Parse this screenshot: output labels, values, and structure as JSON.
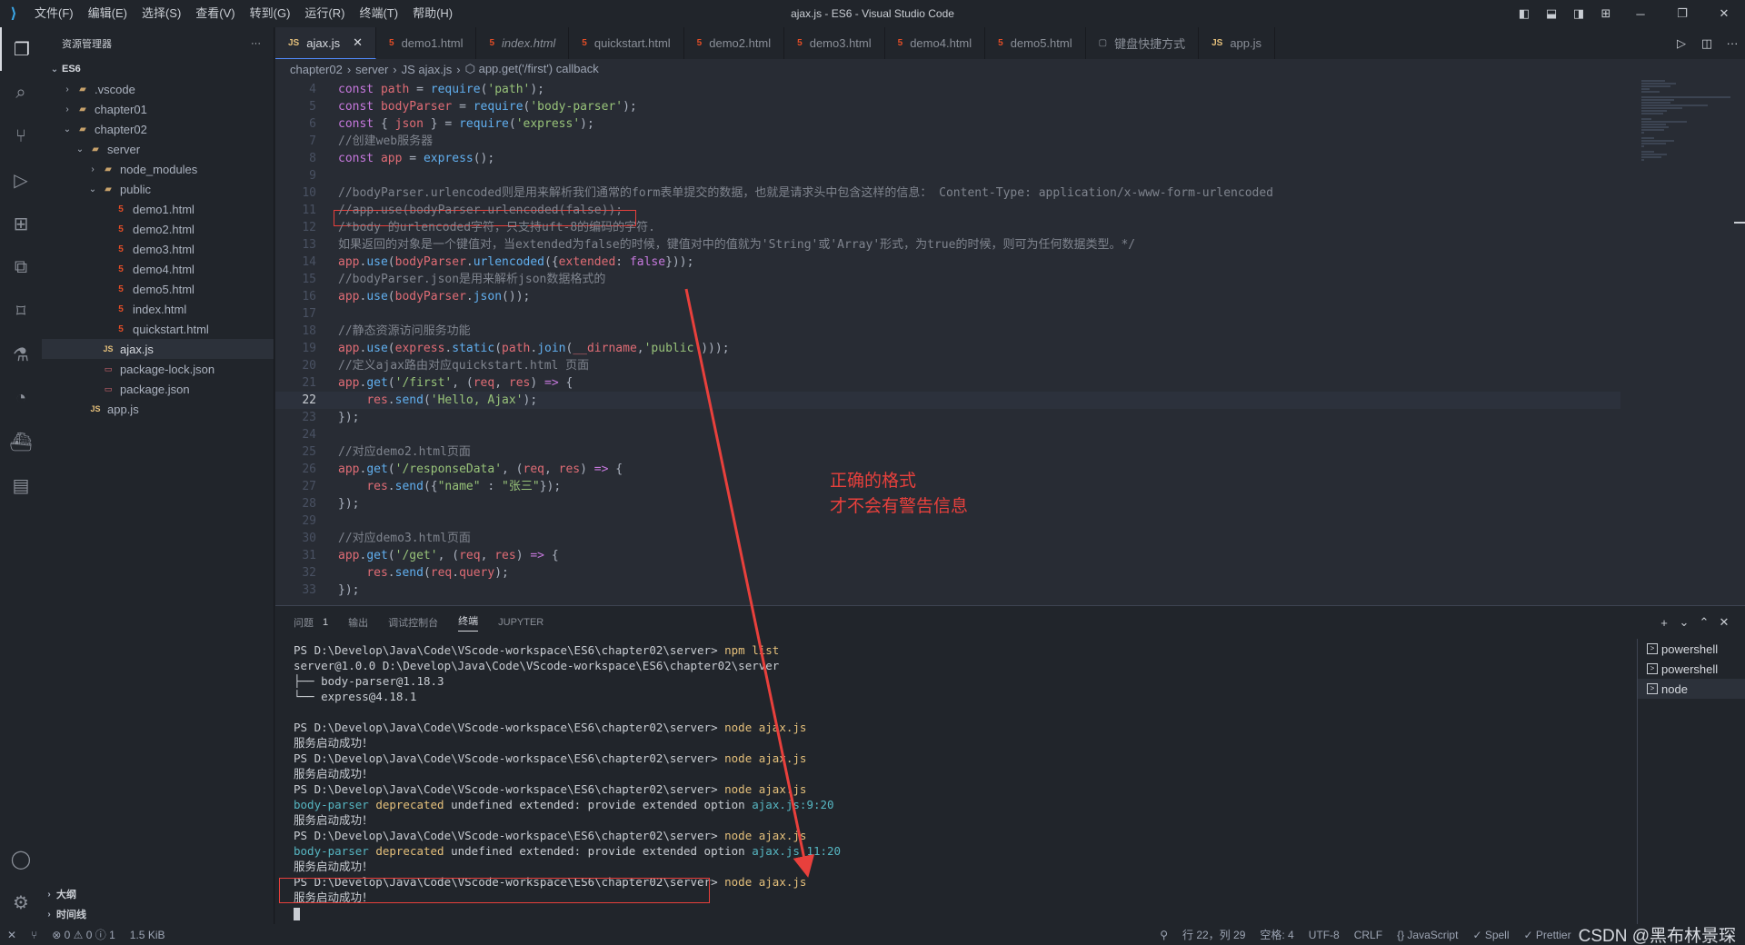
{
  "title_bar": {
    "menu": [
      "文件(F)",
      "编辑(E)",
      "选择(S)",
      "查看(V)",
      "转到(G)",
      "运行(R)",
      "终端(T)",
      "帮助(H)"
    ],
    "title": "ajax.js - ES6 - Visual Studio Code"
  },
  "sidebar": {
    "header": "资源管理器",
    "more": "···",
    "root": "ES6",
    "items": [
      {
        "label": ".vscode",
        "indent": 1,
        "kind": "folder",
        "chevron": "›"
      },
      {
        "label": "chapter01",
        "indent": 1,
        "kind": "folder",
        "chevron": "›"
      },
      {
        "label": "chapter02",
        "indent": 1,
        "kind": "folder",
        "chevron": "⌄"
      },
      {
        "label": "server",
        "indent": 2,
        "kind": "folder",
        "chevron": "⌄"
      },
      {
        "label": "node_modules",
        "indent": 3,
        "kind": "folder",
        "chevron": "›"
      },
      {
        "label": "public",
        "indent": 3,
        "kind": "folder",
        "chevron": "⌄"
      },
      {
        "label": "demo1.html",
        "indent": 4,
        "kind": "html"
      },
      {
        "label": "demo2.html",
        "indent": 4,
        "kind": "html"
      },
      {
        "label": "demo3.html",
        "indent": 4,
        "kind": "html"
      },
      {
        "label": "demo4.html",
        "indent": 4,
        "kind": "html"
      },
      {
        "label": "demo5.html",
        "indent": 4,
        "kind": "html"
      },
      {
        "label": "index.html",
        "indent": 4,
        "kind": "html"
      },
      {
        "label": "quickstart.html",
        "indent": 4,
        "kind": "html"
      },
      {
        "label": "ajax.js",
        "indent": 3,
        "kind": "js",
        "selected": true
      },
      {
        "label": "package-lock.json",
        "indent": 3,
        "kind": "json"
      },
      {
        "label": "package.json",
        "indent": 3,
        "kind": "json"
      },
      {
        "label": "app.js",
        "indent": 2,
        "kind": "js"
      }
    ],
    "outline": "大纲",
    "timeline": "时间线"
  },
  "tabs": [
    {
      "label": "ajax.js",
      "icon": "JS",
      "active": true,
      "close": "✕"
    },
    {
      "label": "demo1.html",
      "icon": "5"
    },
    {
      "label": "index.html",
      "icon": "5",
      "italic": true
    },
    {
      "label": "quickstart.html",
      "icon": "5"
    },
    {
      "label": "demo2.html",
      "icon": "5"
    },
    {
      "label": "demo3.html",
      "icon": "5"
    },
    {
      "label": "demo4.html",
      "icon": "5"
    },
    {
      "label": "demo5.html",
      "icon": "5"
    },
    {
      "label": "键盘快捷方式",
      "icon": "▢"
    },
    {
      "label": "app.js",
      "icon": "JS"
    }
  ],
  "breadcrumb": [
    "chapter02",
    "server",
    "JS ajax.js",
    "⬡ app.get('/first') callback"
  ],
  "code": [
    {
      "n": "4",
      "segs": [
        [
          "kw",
          "const "
        ],
        [
          "var",
          "path"
        ],
        [
          "plain",
          " = "
        ],
        [
          "fn",
          "require"
        ],
        [
          "plain",
          "("
        ],
        [
          "str",
          "'path'"
        ],
        [
          "plain",
          ");"
        ]
      ]
    },
    {
      "n": "5",
      "segs": [
        [
          "kw",
          "const "
        ],
        [
          "var",
          "bodyParser"
        ],
        [
          "plain",
          " = "
        ],
        [
          "fn",
          "require"
        ],
        [
          "plain",
          "("
        ],
        [
          "str",
          "'body-parser'"
        ],
        [
          "plain",
          ");"
        ]
      ]
    },
    {
      "n": "6",
      "segs": [
        [
          "kw",
          "const "
        ],
        [
          "plain",
          "{ "
        ],
        [
          "var",
          "json"
        ],
        [
          "plain",
          " } = "
        ],
        [
          "fn",
          "require"
        ],
        [
          "plain",
          "("
        ],
        [
          "str",
          "'express'"
        ],
        [
          "plain",
          ");"
        ]
      ]
    },
    {
      "n": "7",
      "segs": [
        [
          "com",
          "//创建web服务器"
        ]
      ]
    },
    {
      "n": "8",
      "segs": [
        [
          "kw",
          "const "
        ],
        [
          "var",
          "app"
        ],
        [
          "plain",
          " = "
        ],
        [
          "fn",
          "express"
        ],
        [
          "plain",
          "();"
        ]
      ]
    },
    {
      "n": "9",
      "segs": []
    },
    {
      "n": "10",
      "segs": [
        [
          "com",
          "//bodyParser.urlencoded则是用来解析我们通常的form表单提交的数据，也就是请求头中包含这样的信息： Content-Type: application/x-www-form-urlencoded"
        ]
      ]
    },
    {
      "n": "11",
      "segs": [
        [
          "com",
          "//app.use(bodyParser.urlencoded(false));"
        ]
      ]
    },
    {
      "n": "12",
      "segs": [
        [
          "com",
          "/*body 的urlencoded字符，只支持uft-8的编码的字符."
        ]
      ]
    },
    {
      "n": "13",
      "segs": [
        [
          "com",
          "如果返回的对象是一个键值对，当extended为false的时候，键值对中的值就为'String'或'Array'形式，为true的时候，则可为任何数据类型。*/"
        ]
      ]
    },
    {
      "n": "14",
      "segs": [
        [
          "var",
          "app"
        ],
        [
          "plain",
          "."
        ],
        [
          "fn",
          "use"
        ],
        [
          "plain",
          "("
        ],
        [
          "var",
          "bodyParser"
        ],
        [
          "plain",
          "."
        ],
        [
          "fn",
          "urlencoded"
        ],
        [
          "plain",
          "({"
        ],
        [
          "var",
          "extended"
        ],
        [
          "plain",
          ": "
        ],
        [
          "kw",
          "false"
        ],
        [
          "plain",
          "}));"
        ]
      ]
    },
    {
      "n": "15",
      "segs": [
        [
          "com",
          "//bodyParser.json是用来解析json数据格式的"
        ]
      ]
    },
    {
      "n": "16",
      "segs": [
        [
          "var",
          "app"
        ],
        [
          "plain",
          "."
        ],
        [
          "fn",
          "use"
        ],
        [
          "plain",
          "("
        ],
        [
          "var",
          "bodyParser"
        ],
        [
          "plain",
          "."
        ],
        [
          "fn",
          "json"
        ],
        [
          "plain",
          "());"
        ]
      ]
    },
    {
      "n": "17",
      "segs": []
    },
    {
      "n": "18",
      "segs": [
        [
          "com",
          "//静态资源访问服务功能"
        ]
      ]
    },
    {
      "n": "19",
      "segs": [
        [
          "var",
          "app"
        ],
        [
          "plain",
          "."
        ],
        [
          "fn",
          "use"
        ],
        [
          "plain",
          "("
        ],
        [
          "var",
          "express"
        ],
        [
          "plain",
          "."
        ],
        [
          "fn",
          "static"
        ],
        [
          "plain",
          "("
        ],
        [
          "var",
          "path"
        ],
        [
          "plain",
          "."
        ],
        [
          "fn",
          "join"
        ],
        [
          "plain",
          "("
        ],
        [
          "var",
          "__dirname"
        ],
        [
          "plain",
          ","
        ],
        [
          "str",
          "'public'"
        ],
        [
          "plain",
          ")));"
        ]
      ]
    },
    {
      "n": "20",
      "segs": [
        [
          "com",
          "//定义ajax路由对应quickstart.html 页面"
        ]
      ]
    },
    {
      "n": "21",
      "segs": [
        [
          "var",
          "app"
        ],
        [
          "plain",
          "."
        ],
        [
          "fn",
          "get"
        ],
        [
          "plain",
          "("
        ],
        [
          "str",
          "'/first'"
        ],
        [
          "plain",
          ", ("
        ],
        [
          "var",
          "req"
        ],
        [
          "plain",
          ", "
        ],
        [
          "var",
          "res"
        ],
        [
          "plain",
          ") "
        ],
        [
          "kw",
          "=>"
        ],
        [
          "plain",
          " {"
        ]
      ]
    },
    {
      "n": "22",
      "current": true,
      "segs": [
        [
          "plain",
          "    "
        ],
        [
          "var",
          "res"
        ],
        [
          "plain",
          "."
        ],
        [
          "fn",
          "send"
        ],
        [
          "plain",
          "("
        ],
        [
          "str",
          "'Hello, Ajax'"
        ],
        [
          "plain",
          ");"
        ]
      ]
    },
    {
      "n": "23",
      "segs": [
        [
          "plain",
          "});"
        ]
      ]
    },
    {
      "n": "24",
      "segs": []
    },
    {
      "n": "25",
      "segs": [
        [
          "com",
          "//对应demo2.html页面"
        ]
      ]
    },
    {
      "n": "26",
      "segs": [
        [
          "var",
          "app"
        ],
        [
          "plain",
          "."
        ],
        [
          "fn",
          "get"
        ],
        [
          "plain",
          "("
        ],
        [
          "str",
          "'/responseData'"
        ],
        [
          "plain",
          ", ("
        ],
        [
          "var",
          "req"
        ],
        [
          "plain",
          ", "
        ],
        [
          "var",
          "res"
        ],
        [
          "plain",
          ") "
        ],
        [
          "kw",
          "=>"
        ],
        [
          "plain",
          " {"
        ]
      ]
    },
    {
      "n": "27",
      "segs": [
        [
          "plain",
          "    "
        ],
        [
          "var",
          "res"
        ],
        [
          "plain",
          "."
        ],
        [
          "fn",
          "send"
        ],
        [
          "plain",
          "({"
        ],
        [
          "str",
          "\"name\""
        ],
        [
          "plain",
          " : "
        ],
        [
          "str",
          "\"张三\""
        ],
        [
          "plain",
          "});"
        ]
      ]
    },
    {
      "n": "28",
      "segs": [
        [
          "plain",
          "});"
        ]
      ]
    },
    {
      "n": "29",
      "segs": []
    },
    {
      "n": "30",
      "segs": [
        [
          "com",
          "//对应demo3.html页面"
        ]
      ]
    },
    {
      "n": "31",
      "segs": [
        [
          "var",
          "app"
        ],
        [
          "plain",
          "."
        ],
        [
          "fn",
          "get"
        ],
        [
          "plain",
          "("
        ],
        [
          "str",
          "'/get'"
        ],
        [
          "plain",
          ", ("
        ],
        [
          "var",
          "req"
        ],
        [
          "plain",
          ", "
        ],
        [
          "var",
          "res"
        ],
        [
          "plain",
          ") "
        ],
        [
          "kw",
          "=>"
        ],
        [
          "plain",
          " {"
        ]
      ]
    },
    {
      "n": "32",
      "segs": [
        [
          "plain",
          "    "
        ],
        [
          "var",
          "res"
        ],
        [
          "plain",
          "."
        ],
        [
          "fn",
          "send"
        ],
        [
          "plain",
          "("
        ],
        [
          "var",
          "req"
        ],
        [
          "plain",
          "."
        ],
        [
          "var",
          "query"
        ],
        [
          "plain",
          ");"
        ]
      ]
    },
    {
      "n": "33",
      "segs": [
        [
          "plain",
          "});"
        ]
      ]
    }
  ],
  "annotation": {
    "line1": "正确的格式",
    "line2": "才不会有警告信息",
    "color": "#e8403c"
  },
  "panel": {
    "tabs": [
      {
        "label": "问题",
        "badge": "1"
      },
      {
        "label": "输出"
      },
      {
        "label": "调试控制台"
      },
      {
        "label": "终端",
        "active": true
      },
      {
        "label": "JUPYTER"
      }
    ],
    "terminal": [
      [
        [
          "prompt",
          "PS D:\\Develop\\Java\\Code\\VScode-workspace\\ES6\\chapter02\\server> "
        ],
        [
          "cmd",
          "npm list"
        ]
      ],
      [
        [
          "plain",
          "server@1.0.0 D:\\Develop\\Java\\Code\\VScode-workspace\\ES6\\chapter02\\server"
        ]
      ],
      [
        [
          "plain",
          "├── body-parser@1.18.3"
        ]
      ],
      [
        [
          "plain",
          "└── express@4.18.1"
        ]
      ],
      [],
      [
        [
          "prompt",
          "PS D:\\Develop\\Java\\Code\\VScode-workspace\\ES6\\chapter02\\server> "
        ],
        [
          "cmd",
          "node ajax.js"
        ]
      ],
      [
        [
          "plain",
          "服务启动成功！"
        ]
      ],
      [
        [
          "prompt",
          "PS D:\\Develop\\Java\\Code\\VScode-workspace\\ES6\\chapter02\\server> "
        ],
        [
          "cmd",
          "node ajax.js"
        ]
      ],
      [
        [
          "plain",
          "服务启动成功！"
        ]
      ],
      [
        [
          "prompt",
          "PS D:\\Develop\\Java\\Code\\VScode-workspace\\ES6\\chapter02\\server> "
        ],
        [
          "cmd",
          "node ajax.js"
        ]
      ],
      [
        [
          "cyan",
          "body-parser "
        ],
        [
          "yel",
          "deprecated "
        ],
        [
          "plain",
          "undefined extended: provide extended option "
        ],
        [
          "link",
          "ajax.js:9:20"
        ]
      ],
      [
        [
          "plain",
          "服务启动成功！"
        ]
      ],
      [
        [
          "prompt",
          "PS D:\\Develop\\Java\\Code\\VScode-workspace\\ES6\\chapter02\\server> "
        ],
        [
          "cmd",
          "node ajax.js"
        ]
      ],
      [
        [
          "cyan",
          "body-parser "
        ],
        [
          "yel",
          "deprecated "
        ],
        [
          "plain",
          "undefined extended: provide extended option "
        ],
        [
          "link",
          "ajax.js:11:20"
        ]
      ],
      [
        [
          "plain",
          "服务启动成功！"
        ]
      ],
      [
        [
          "prompt",
          "PS D:\\Develop\\Java\\Code\\VScode-workspace\\ES6\\chapter02\\server> "
        ],
        [
          "cmd",
          "node ajax.js"
        ]
      ],
      [
        [
          "plain",
          "服务启动成功！"
        ]
      ]
    ],
    "terminal_list": [
      {
        "label": "powershell"
      },
      {
        "label": "powershell"
      },
      {
        "label": "node",
        "active": true
      }
    ]
  },
  "status": {
    "errors": "⊗ 0",
    "warnings": "⚠ 0",
    "info": "ⓘ 1",
    "size": "1.5 KiB",
    "position": "行 22，列 29",
    "spaces": "空格: 4",
    "encoding": "UTF-8",
    "eol": "CRLF",
    "language": "{} JavaScript",
    "spell": "✓ Spell",
    "prettier": "✓ Prettier",
    "watermark": "CSDN @黑布林景琛"
  }
}
